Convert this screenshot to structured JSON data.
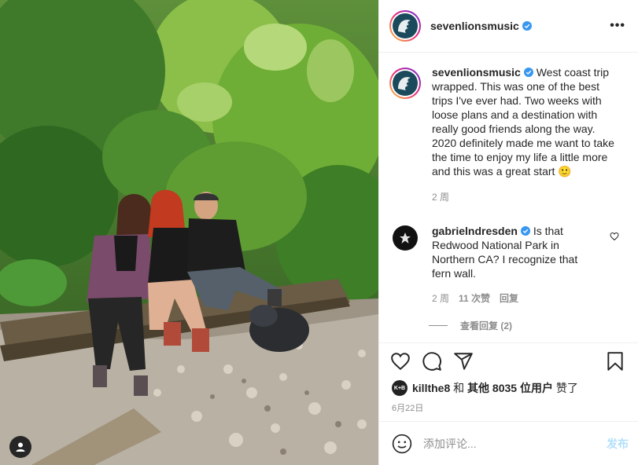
{
  "post": {
    "username": "sevenlionsmusic",
    "more_label": "•••",
    "caption": {
      "username": "sevenlionsmusic",
      "text": "West coast trip wrapped. This was one of the best trips I've ever had. Two weeks with loose plans and a destination with really good friends along the way. 2020 definitely made me want to take the time to enjoy my life a little more and this was a great start 🙂",
      "age": "2 周"
    },
    "comments": [
      {
        "username": "gabrielndresden",
        "text": "Is that Redwood National Park in Northern CA? I recognize that fern wall.",
        "age": "2 周",
        "likes": "11 次赞",
        "reply_label": "回复",
        "view_replies": "查看回复 (2)"
      }
    ],
    "likes": {
      "avatar_text": "K+B",
      "user": "killthe8",
      "connector": "和",
      "others": "其他 8035 位用户",
      "suffix": "赞了"
    },
    "date": "6月22日",
    "add_comment_placeholder": "添加评论...",
    "post_button": "发布"
  },
  "colors": {
    "accent_blue": "#0095f6",
    "post_disabled": "#b2dffc",
    "verified": "#3897f0",
    "muted": "#8e8e8e"
  },
  "icons": [
    "user-tag-icon",
    "more-icon",
    "verified-icon",
    "heart-icon",
    "comment-icon",
    "share-icon",
    "bookmark-icon",
    "emoji-icon"
  ]
}
